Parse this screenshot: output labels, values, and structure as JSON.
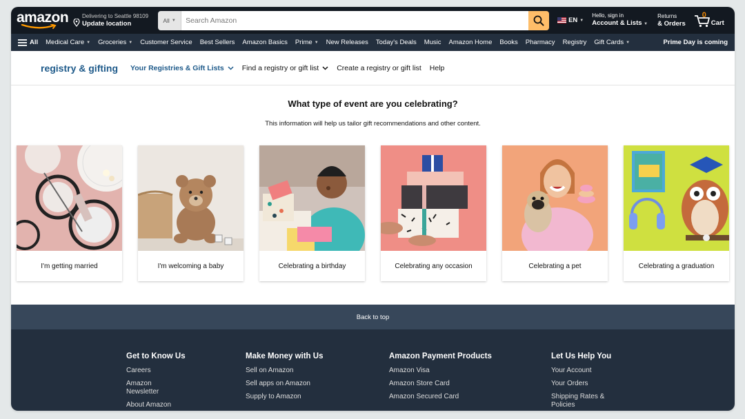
{
  "header": {
    "logo": "amazon",
    "deliver_line1": "Delivering to Seattle 98109",
    "deliver_line2": "Update location",
    "search_dept": "All",
    "search_placeholder": "Search Amazon",
    "lang": "EN",
    "account_line1": "Hello, sign in",
    "account_line2": "Account & Lists",
    "returns_line1": "Returns",
    "returns_line2": "& Orders",
    "cart_count": "0",
    "cart_label": "Cart"
  },
  "subnav": {
    "all_label": "All",
    "items": [
      "Medical Care",
      "Groceries",
      "Customer Service",
      "Best Sellers",
      "Amazon Basics",
      "Prime",
      "New Releases",
      "Today's Deals",
      "Music",
      "Amazon Home",
      "Books",
      "Pharmacy",
      "Registry",
      "Gift Cards"
    ],
    "promo": "Prime Day is coming"
  },
  "registry": {
    "title": "registry & gifting",
    "links": [
      "Your Registries & Gift Lists",
      "Find a registry or gift list",
      "Create a registry or gift list",
      "Help"
    ]
  },
  "main": {
    "question": "What type of event are you celebrating?",
    "subtitle": "This information will help us tailor gift recommendations and other content.",
    "cards": [
      {
        "label": "I'm getting married",
        "icon": "wedding-table-image"
      },
      {
        "label": "I'm welcoming a baby",
        "icon": "teddy-bear-image"
      },
      {
        "label": "Celebrating a birthday",
        "icon": "birthday-boy-image"
      },
      {
        "label": "Celebrating any occasion",
        "icon": "gift-stack-image"
      },
      {
        "label": "Celebrating a pet",
        "icon": "woman-with-pug-image"
      },
      {
        "label": "Celebrating a graduation",
        "icon": "graduation-owl-image"
      }
    ]
  },
  "footer": {
    "back_to_top": "Back to top",
    "columns": [
      {
        "title": "Get to Know Us",
        "links": [
          "Careers",
          "Amazon Newsletter",
          "About Amazon"
        ]
      },
      {
        "title": "Make Money with Us",
        "links": [
          "Sell on Amazon",
          "Sell apps on Amazon",
          "Supply to Amazon"
        ]
      },
      {
        "title": "Amazon Payment Products",
        "links": [
          "Amazon Visa",
          "Amazon Store Card",
          "Amazon Secured Card"
        ]
      },
      {
        "title": "Let Us Help You",
        "links": [
          "Your Account",
          "Your Orders",
          "Shipping Rates & Policies"
        ]
      }
    ]
  },
  "colors": {
    "nav_top": "#131921",
    "nav_sub": "#232f3e",
    "search_button": "#febd69",
    "registry_blue": "#1e5a8a",
    "back_top": "#37475a"
  }
}
